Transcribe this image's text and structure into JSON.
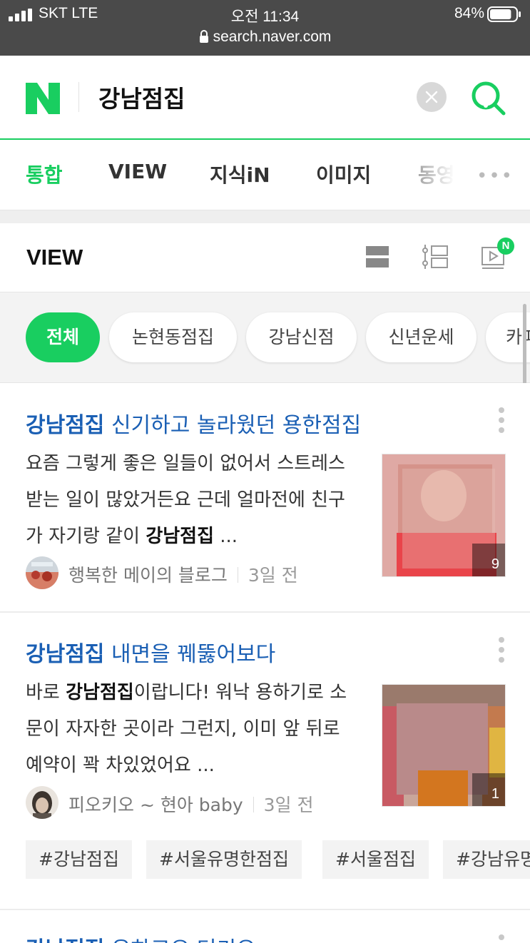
{
  "status_bar": {
    "carrier": "SKT  LTE",
    "time": "오전 11:34",
    "battery": "84%",
    "battery_level": 0.84,
    "url": "search.naver.com"
  },
  "search": {
    "logo": "N",
    "query": "강남점집",
    "brand_color": "#19ce60"
  },
  "tabs": [
    "통합",
    "VIEW",
    "지식iN",
    "이미지",
    "동영"
  ],
  "tabs_more": "•••",
  "view_section": {
    "title": "VIEW",
    "new_badge": "N"
  },
  "chips": [
    "전체",
    "논현동점집",
    "강남신점",
    "신년운세",
    "카페"
  ],
  "results": [
    {
      "title_keyword": "강남점집",
      "title_rest": " 신기하고 놀라웠던 용한점집",
      "desc_before": "요즘 그렇게 좋은 일들이 없어서 스트레스 받는 일이 많았거든요 근데 얼마전에 친구가 자기랑 같이 ",
      "desc_keyword": "강남점집",
      "desc_after": " ...",
      "source": "행복한 메이의 블로그",
      "date": "3일 전",
      "thumb_count": "9"
    },
    {
      "title_keyword": "강남점집",
      "title_rest": " 내면을 꿰뚫어보다",
      "desc_before": "바로 ",
      "desc_keyword": "강남점집",
      "desc_after": "이랍니다! 워낙 용하기로 소문이 자자한 곳이라 그런지, 이미 앞 뒤로 예약이 꽉 차있었어요 ...",
      "source": "피오키오 ~ 현아 baby",
      "date": "3일 전",
      "thumb_count": "1",
      "tags": [
        "#강남점집",
        "#서울유명한점집",
        "#서울점집",
        "#강남유명"
      ]
    },
    {
      "title_keyword": "강남점집",
      "title_rest": " 유하고요 터키오"
    }
  ]
}
